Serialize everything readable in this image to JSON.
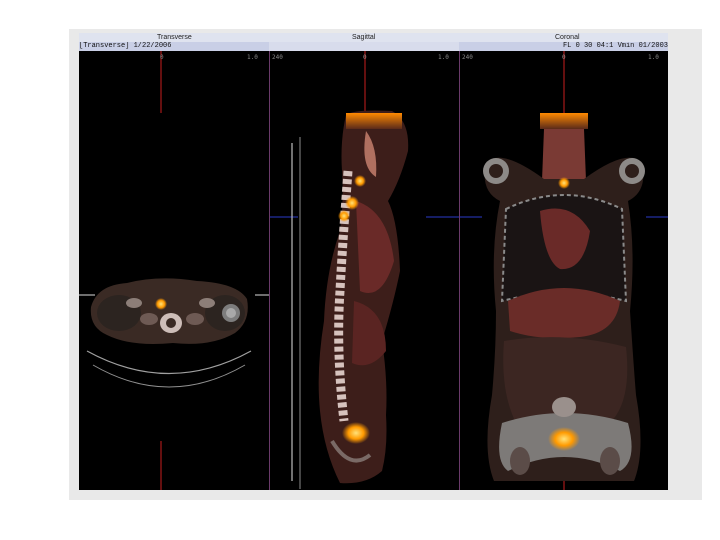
{
  "views": {
    "transverse": {
      "title": "Transverse",
      "info": "[Transverse] 1/22/2006"
    },
    "sagittal": {
      "title": "Sagittal"
    },
    "coronal": {
      "title": "Coronal",
      "info": "FL 0 30 04:1 Vmin 01/2003"
    }
  },
  "overlay_colors": {
    "crosshair_vertical": "#c81e1e",
    "crosshair_horizontal": "#2a3ac8",
    "pet_hotspot": "#ffb400"
  }
}
